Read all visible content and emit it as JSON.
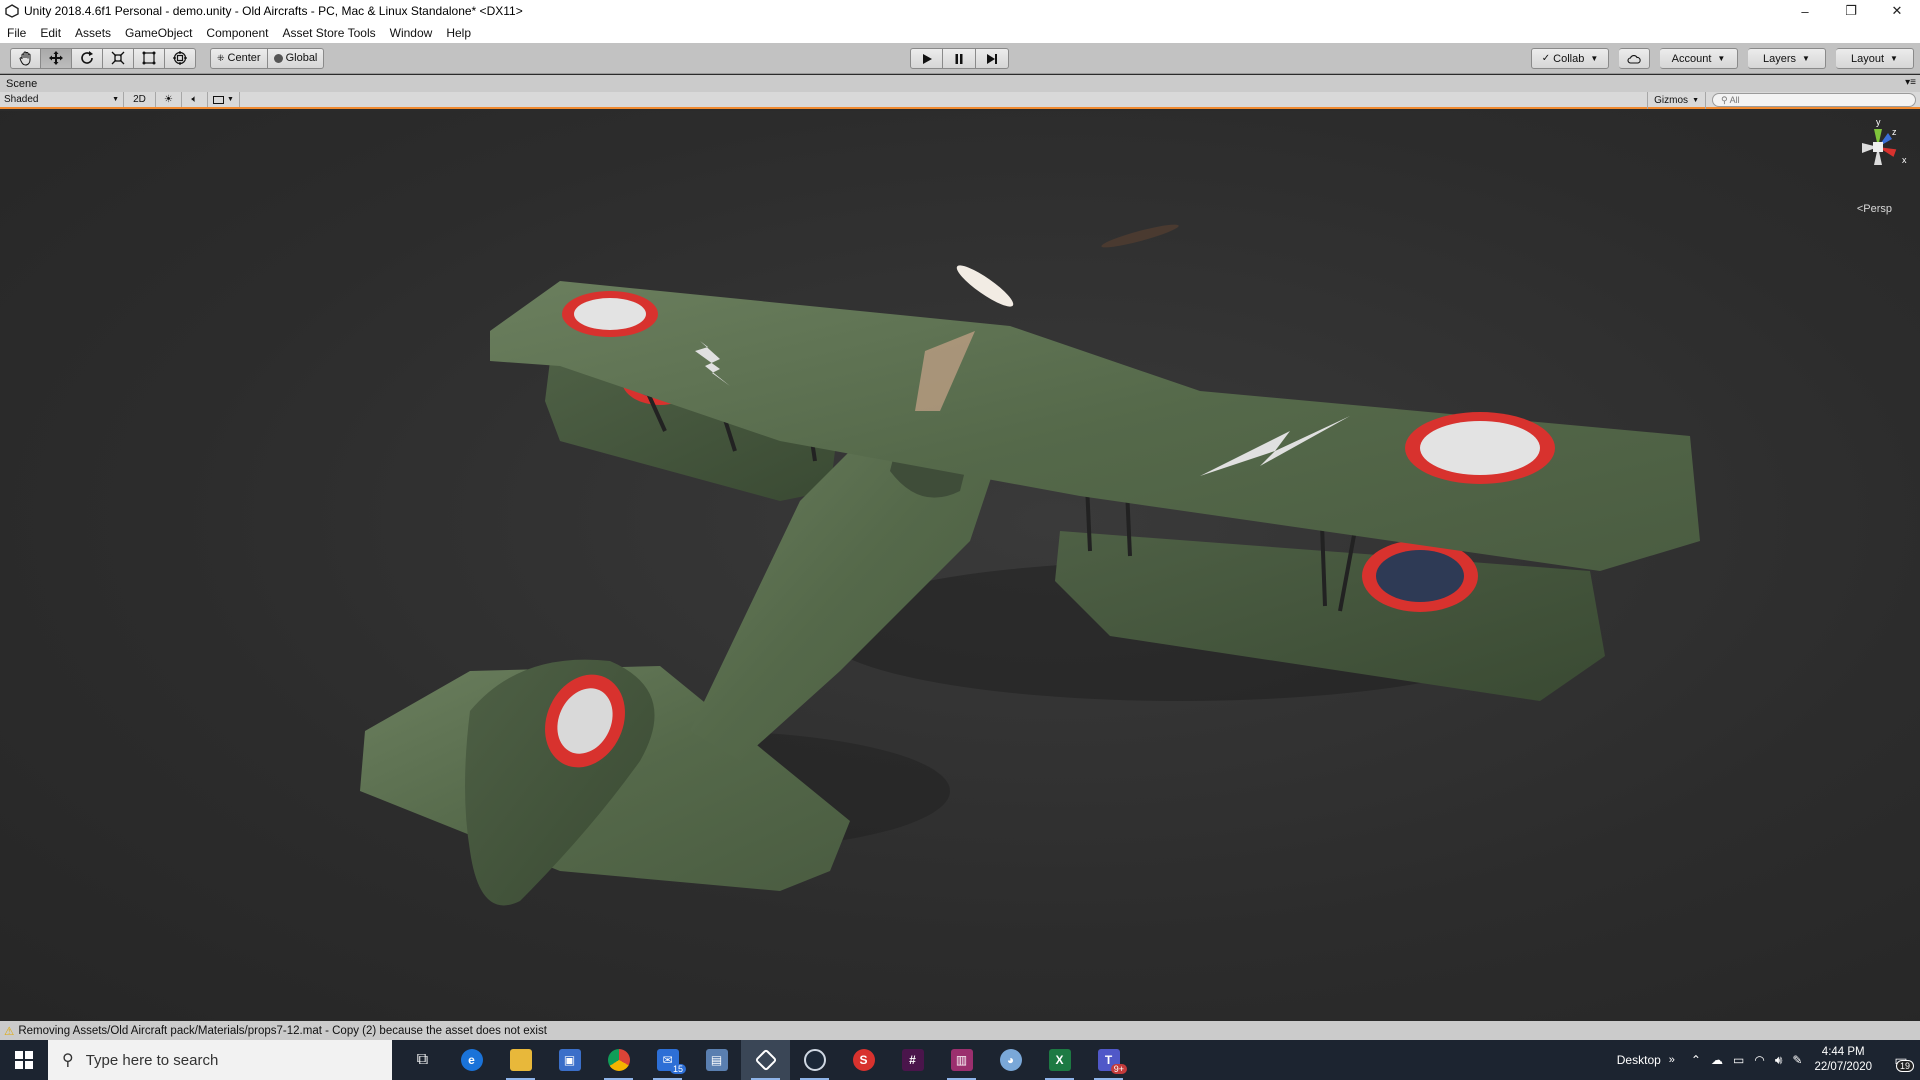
{
  "window": {
    "title": "Unity 2018.4.6f1 Personal - demo.unity - Old Aircrafts - PC, Mac & Linux Standalone* <DX11>",
    "minimize": "–",
    "restore": "❐",
    "close": "✕"
  },
  "menu": [
    "File",
    "Edit",
    "Assets",
    "GameObject",
    "Component",
    "Asset Store Tools",
    "Window",
    "Help"
  ],
  "toolbar": {
    "center_label": "Center",
    "global_label": "Global",
    "collab_label": "Collab",
    "account_label": "Account",
    "layers_label": "Layers",
    "layout_label": "Layout"
  },
  "scene": {
    "tab_label": "Scene",
    "shading_mode": "Shaded",
    "mode_2d": "2D",
    "gizmos_label": "Gizmos",
    "search_placeholder": "All",
    "persp_label": "Persp",
    "axis_y": "y",
    "axis_z": "z",
    "axis_x": "x"
  },
  "status": {
    "message": "Removing Assets/Old Aircraft pack/Materials/props7-12.mat - Copy (2) because the asset does not exist"
  },
  "taskbar": {
    "search_placeholder": "Type here to search",
    "outlook_badge": "15",
    "teams_badge": "9+",
    "desktop_label": "Desktop",
    "time": "4:44 PM",
    "date": "22/07/2020",
    "notification_count": "19"
  },
  "colors": {
    "accent_orange": "#f08a30",
    "camo_green": "#556b48",
    "roundel_red": "#d8322e"
  }
}
